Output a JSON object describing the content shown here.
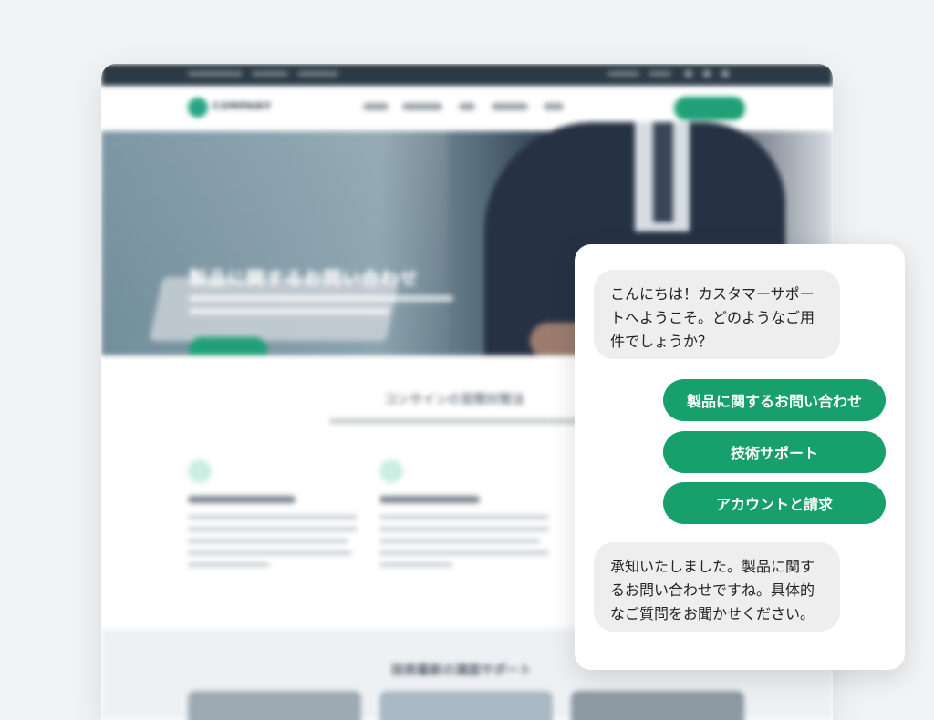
{
  "background_site": {
    "logo_text": "COMPANY",
    "hero_title": "製品に関するお問い合わせ",
    "features_title": "コンサインの宮際対策法",
    "support_title": "技術最新の満面サポート"
  },
  "chat": {
    "greeting": "こんにちは！カスタマーサポートへようこそ。どのようなご用件でしょうか？",
    "options": [
      {
        "label": "製品に関するお問い合わせ"
      },
      {
        "label": "技術サポート"
      },
      {
        "label": "アカウントと請求"
      }
    ],
    "reply": "承知いたしました。製品に関するお問い合わせですね。具体的なご質問をお聞かせください。"
  },
  "colors": {
    "accent": "#18a06c",
    "bot_bubble": "#eeeeee",
    "page_background": "#f1f3f5"
  }
}
